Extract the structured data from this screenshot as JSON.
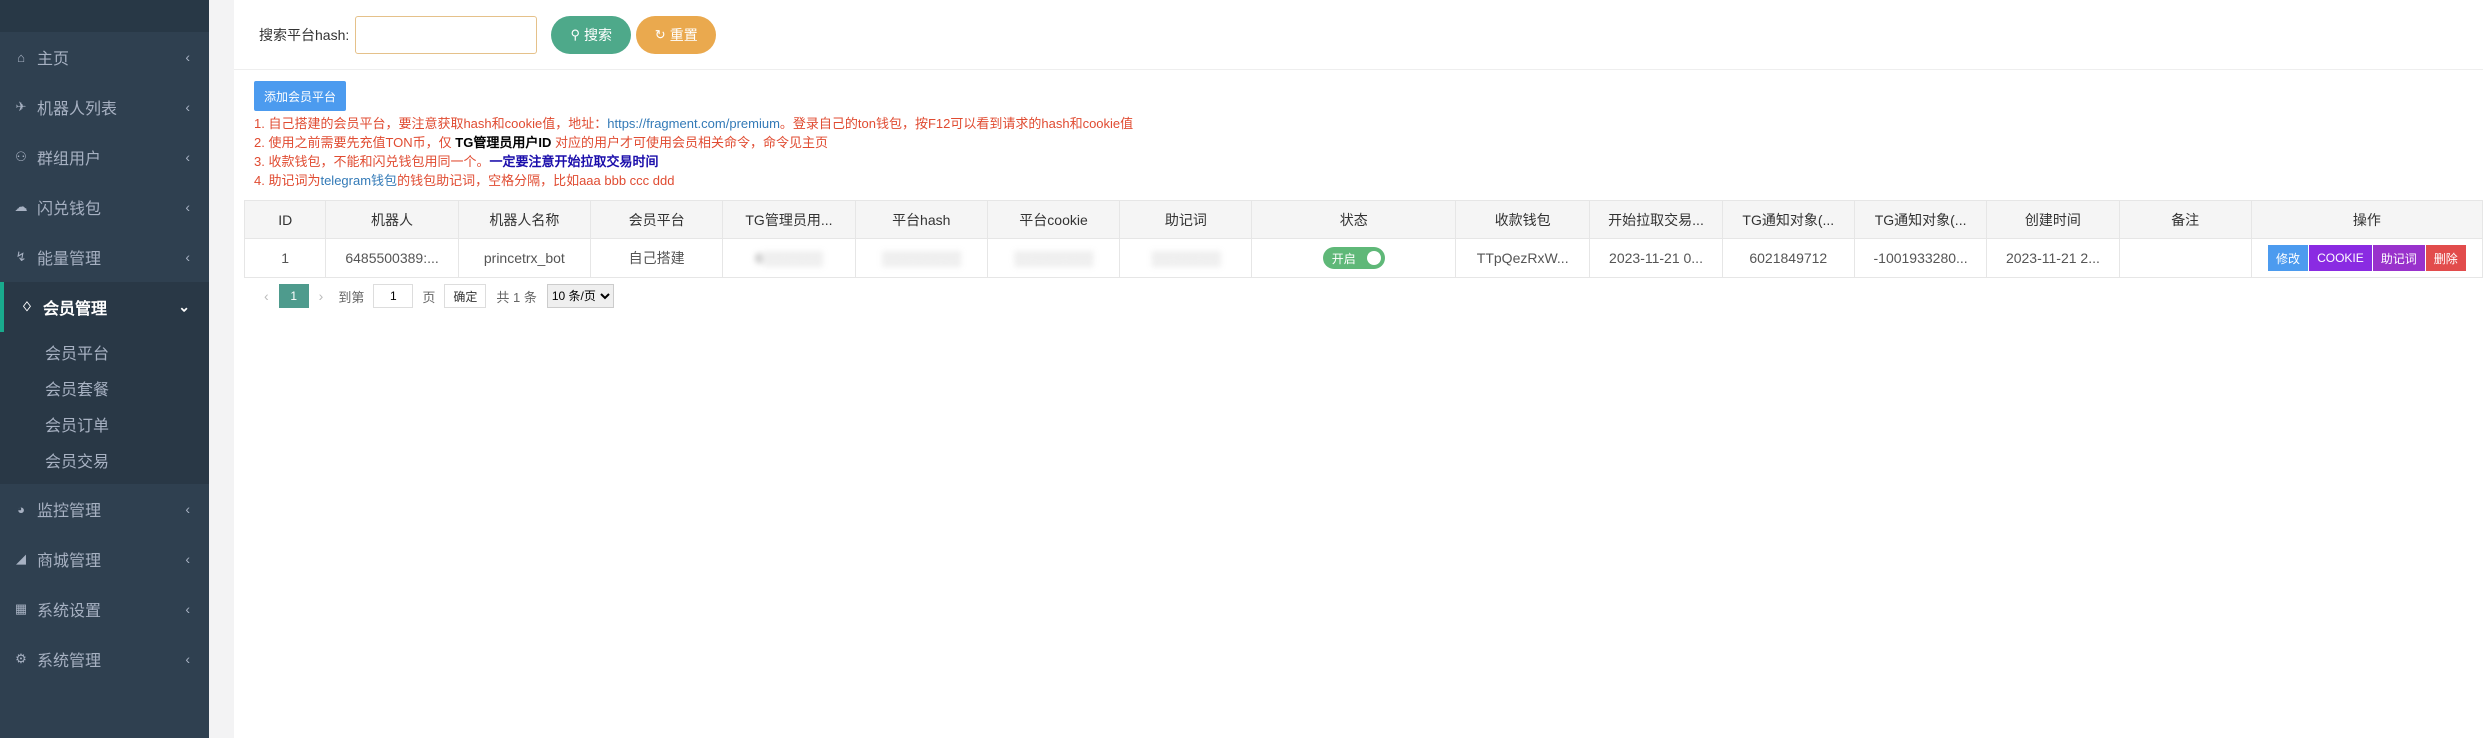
{
  "sidebar": {
    "items": [
      {
        "label": "主页",
        "icon": "home-icon"
      },
      {
        "label": "机器人列表",
        "icon": "plane-icon"
      },
      {
        "label": "群组用户",
        "icon": "users-icon"
      },
      {
        "label": "闪兑钱包",
        "icon": "cloud-icon"
      },
      {
        "label": "能量管理",
        "icon": "bolt-icon"
      },
      {
        "label": "会员管理",
        "icon": "diamond-icon"
      },
      {
        "label": "监控管理",
        "icon": "pie-icon"
      },
      {
        "label": "商城管理",
        "icon": "cart-icon"
      },
      {
        "label": "系统设置",
        "icon": "windows-icon"
      },
      {
        "label": "系统管理",
        "icon": "gear-icon"
      }
    ],
    "sub_items": [
      "会员平台",
      "会员套餐",
      "会员订单",
      "会员交易"
    ]
  },
  "search": {
    "label": "搜索平台hash:",
    "value": "",
    "search_button": "搜索",
    "reset_button": "重置"
  },
  "toolbar": {
    "add_button": "添加会员平台"
  },
  "notes": {
    "n1_a": "1. 自己搭建的会员平台，要注意获取hash和cookie值，地址：",
    "n1_link": "https://fragment.com/premium",
    "n1_b": "。登录自己的ton钱包，按F12可以看到请求的hash和cookie值",
    "n2_a": "2. 使用之前需要先充值TON币，仅 ",
    "n2_bold": "TG管理员用户ID",
    "n2_b": " 对应的用户才可使用会员相关命令，命令见主页",
    "n3_a": "3. 收款钱包，不能和闪兑钱包用同一个。",
    "n3_bold": "一定要注意开始拉取交易时间",
    "n4_a": "4. 助记词为",
    "n4_link": "telegram钱包",
    "n4_b": "的钱包助记词，空格分隔，比如aaa bbb ccc ddd"
  },
  "table": {
    "headers": [
      "ID",
      "机器人",
      "机器人名称",
      "会员平台",
      "TG管理员用...",
      "平台hash",
      "平台cookie",
      "助记词",
      "状态",
      "收款钱包",
      "开始拉取交易...",
      "TG通知对象(...",
      "TG通知对象(...",
      "创建时间",
      "备注",
      "操作"
    ],
    "rows": [
      {
        "id": "1",
        "bot": "6485500389:...",
        "bot_name": "princetrx_bot",
        "platform": "自己搭建",
        "admin_id": "6░░░░░░",
        "hash": "░░░░░░░░",
        "cookie": "░░░░░░░░",
        "mnemonic": "░░░░░░░",
        "status": "开启",
        "wallet": "TTpQezRxW...",
        "start_time": "2023-11-21 0...",
        "notify1": "6021849712",
        "notify2": "-1001933280...",
        "created": "2023-11-21 2...",
        "remark": "",
        "ops": {
          "edit": "修改",
          "cookie": "COOKIE",
          "mnemonic": "助记词",
          "delete": "删除"
        }
      }
    ]
  },
  "pager": {
    "current": "1",
    "goto_label": "到第",
    "goto_value": "1",
    "page_unit": "页",
    "confirm": "确定",
    "total": "共 1 条",
    "page_size": "10 条/页"
  }
}
